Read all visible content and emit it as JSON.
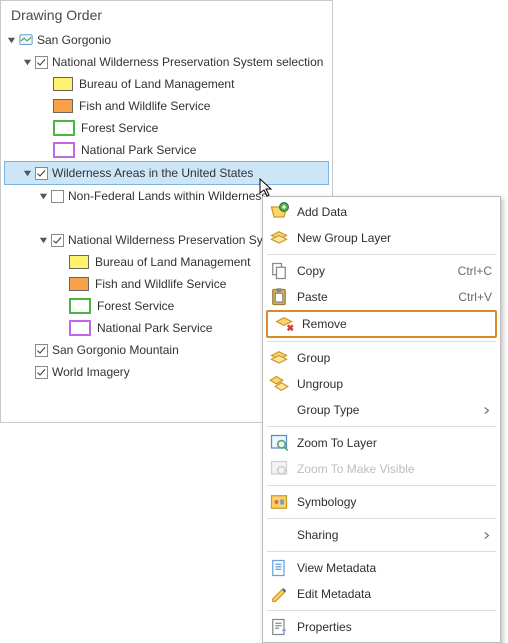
{
  "panel": {
    "title": "Drawing Order"
  },
  "tree": {
    "root": {
      "label": "San Gorgonio",
      "children": [
        {
          "label": "National Wilderness Preservation System selection",
          "checked": true,
          "expanded": true,
          "symbols": [
            {
              "label": "Bureau of Land Management",
              "color": "#FEF26E"
            },
            {
              "label": "Fish and Wildlife Service",
              "color": "#F7A24B"
            },
            {
              "label": "Forest Service",
              "color": "#7FD065"
            },
            {
              "label": "National Park Service",
              "color": "#C366E8"
            }
          ]
        },
        {
          "label": "Wilderness Areas in the United States",
          "checked": true,
          "expanded": true,
          "selected": true,
          "children": [
            {
              "label": "Non-Federal Lands within Wilderness",
              "checked": false,
              "expanded": true,
              "symbols": [
                {
                  "label": "",
                  "color": ""
                }
              ]
            },
            {
              "label": "National Wilderness Preservation Syste",
              "checked": true,
              "expanded": true,
              "symbols": [
                {
                  "label": "Bureau of Land Management",
                  "color": "#FEF26E"
                },
                {
                  "label": "Fish and Wildlife Service",
                  "color": "#F7A24B"
                },
                {
                  "label": "Forest Service",
                  "color": "#7FD065"
                },
                {
                  "label": "National Park Service",
                  "color": "#C366E8"
                }
              ]
            }
          ]
        },
        {
          "label": "San Gorgonio Mountain",
          "checked": true,
          "expanded": false
        },
        {
          "label": "World Imagery",
          "checked": true,
          "expanded": false
        }
      ]
    }
  },
  "menu": {
    "items": [
      {
        "label": "Add Data",
        "icon": "add-data"
      },
      {
        "label": "New Group Layer",
        "icon": "group-layer"
      }
    ],
    "clipboard": [
      {
        "label": "Copy",
        "shortcut": "Ctrl+C",
        "icon": "copy"
      },
      {
        "label": "Paste",
        "shortcut": "Ctrl+V",
        "icon": "paste"
      }
    ],
    "remove": {
      "label": "Remove",
      "icon": "remove"
    },
    "grouping": [
      {
        "label": "Group",
        "icon": "group"
      },
      {
        "label": "Ungroup",
        "icon": "ungroup"
      },
      {
        "label": "Group Type",
        "submenu": true
      }
    ],
    "zoom": [
      {
        "label": "Zoom To Layer",
        "icon": "zoom-layer"
      },
      {
        "label": "Zoom To Make Visible",
        "icon": "zoom-visible",
        "disabled": true
      }
    ],
    "symbology": {
      "label": "Symbology",
      "icon": "symbology"
    },
    "sharing": {
      "label": "Sharing",
      "submenu": true
    },
    "metadata": [
      {
        "label": "View Metadata",
        "icon": "view-meta"
      },
      {
        "label": "Edit Metadata",
        "icon": "edit-meta"
      }
    ],
    "properties": {
      "label": "Properties",
      "icon": "properties"
    }
  }
}
